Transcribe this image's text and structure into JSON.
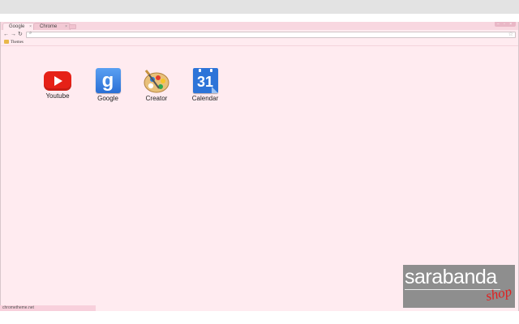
{
  "browser": {
    "tabs": [
      {
        "label": "Google",
        "active": true
      },
      {
        "label": "Chrome",
        "active": false
      }
    ],
    "tab_close_glyph": "×",
    "window_controls_glyph": "‒ ▫ ×",
    "nav": {
      "back_glyph": "←",
      "forward_glyph": "→",
      "reload_glyph": "↻",
      "search_glyph": "⌕",
      "star_glyph": "☆"
    },
    "omnibox": {
      "value": "",
      "placeholder": ""
    },
    "bookmarks": [
      {
        "label": "Themes",
        "icon": "folder-icon"
      }
    ],
    "status_text": "chrometheme.net"
  },
  "apps": [
    {
      "label": "Youtube",
      "icon": "youtube-icon"
    },
    {
      "label": "Google",
      "icon": "google-icon"
    },
    {
      "label": "Creator",
      "icon": "palette-icon"
    },
    {
      "label": "Calendar",
      "icon": "calendar-icon"
    }
  ],
  "app_icon_text": {
    "google_letter": "g",
    "calendar_day": "31"
  },
  "logo": {
    "brand": "sarabanda",
    "tagline": "shop"
  },
  "colors": {
    "page_background": "#ffebf0",
    "tabbar": "#f8d7e0",
    "youtube_red": "#e62117",
    "google_blue": "#2a6fd5",
    "logo_gray": "#8e8e8e",
    "logo_red": "#e02020"
  }
}
